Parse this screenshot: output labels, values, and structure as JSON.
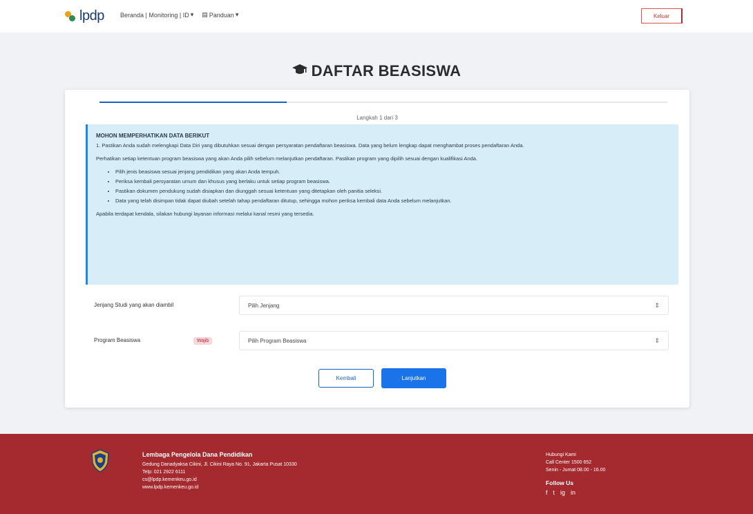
{
  "header": {
    "logo_text": "lpdp",
    "nav": [
      {
        "label": "Beranda | Monitoring | ID"
      },
      {
        "label": "Panduan"
      }
    ],
    "logout_label": "Keluar"
  },
  "page": {
    "title": "DAFTAR BEASISWA",
    "title_icon": "graduation-cap-icon"
  },
  "wizard": {
    "progress": 0.33,
    "step_label": "Langkah 1 dari 3"
  },
  "info": {
    "title": "MOHON MEMPERHATIKAN DATA BERIKUT",
    "para1": "1. Pastikan Anda sudah melengkapi Data Diri yang dibutuhkan sesuai dengan persyaratan pendaftaran beasiswa. Data yang belum lengkap dapat menghambat proses pendaftaran Anda.",
    "para2": "Perhatikan setiap ketentuan program beasiswa yang akan Anda pilih sebelum melanjutkan pendaftaran. Pastikan program yang dipilih sesuai dengan kualifikasi Anda.",
    "list": [
      "Pilih jenis beasiswa sesuai jenjang pendidikan yang akan Anda tempuh.",
      "Periksa kembali persyaratan umum dan khusus yang berlaku untuk setiap program beasiswa.",
      "Pastikan dokumen pendukung sudah disiapkan dan diunggah sesuai ketentuan yang ditetapkan oleh panitia seleksi.",
      "Data yang telah disimpan tidak dapat diubah setelah tahap pendaftaran ditutup, sehingga mohon periksa kembali data Anda sebelum melanjutkan."
    ],
    "para3": "Apabila terdapat kendala, silakan hubungi layanan informasi melalui kanal resmi yang tersedia."
  },
  "form": {
    "field1_label": "Jenjang Studi yang akan diambil",
    "field1_value": "Pilih Jenjang",
    "field2_label": "Program Beasiswa",
    "field2_badge": "Wajib",
    "field2_value": "Pilih Program Beasiswa"
  },
  "buttons": {
    "back": "Kembali",
    "next": "Lanjutkan"
  },
  "footer": {
    "org": "Lembaga Pengelola Dana Pendidikan",
    "address": "Gedung Danadyaksa Cikini, Jl. Cikini Raya No. 91, Jakarta Pusat 10330",
    "phone": "Telp: 021 2922 6111",
    "email": "cs@lpdp.kemenkeu.go.id",
    "site": "www.lpdp.kemenkeu.go.id",
    "contact_title": "Hubungi Kami",
    "contact_lines": [
      "Call Center 1500 652",
      "Senin - Jumat 08.00 - 16.00"
    ],
    "follow_title": "Follow Us",
    "social": [
      "f",
      "t",
      "ig",
      "in"
    ],
    "bg_color": "#a52a2f"
  }
}
